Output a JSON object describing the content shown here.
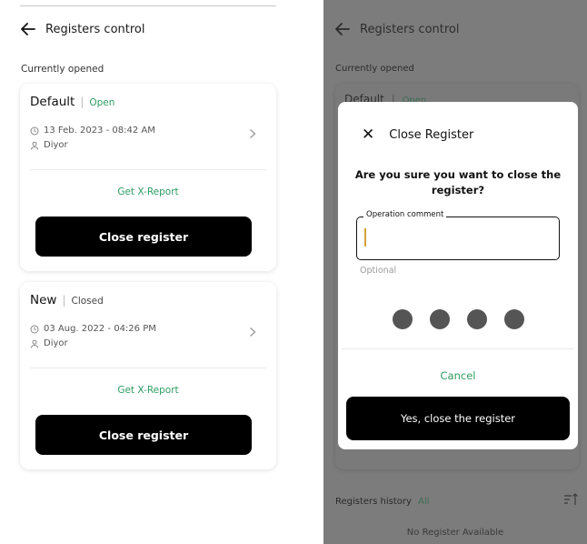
{
  "left": {
    "title": "Registers control",
    "section_label": "Currently opened",
    "cards": [
      {
        "name": "Default",
        "status": "Open",
        "datetime": "13 Feb. 2023 - 08:42 AM",
        "user": "Diyor",
        "report_label": "Get X-Report",
        "close_label": "Close register"
      },
      {
        "name": "New",
        "status": "Closed",
        "datetime": "03 Aug. 2022 - 04:26 PM",
        "user": "Diyor",
        "report_label": "Get X-Report",
        "close_label": "Close register"
      }
    ]
  },
  "right": {
    "title": "Registers control",
    "section_label": "Currently opened",
    "peek_name": "Default",
    "peek_status": "Open",
    "history_label": "Registers history",
    "history_filter": "All",
    "empty_text": "No Register Available",
    "modal": {
      "title": "Close Register",
      "question": "Are you sure you want to close the register?",
      "field_label": "Operation comment",
      "field_value": "",
      "optional_hint": "Optional",
      "pin_dots": 4,
      "cancel_label": "Cancel",
      "confirm_label": "Yes, close the register"
    }
  },
  "colors": {
    "accent_green": "#2e9b63",
    "button_black": "#000000",
    "overlay_gray": "#7c7c7c"
  },
  "icons": [
    "back-arrow-icon",
    "clock-icon",
    "user-icon",
    "chevron-right-icon",
    "close-icon",
    "sort-icon"
  ]
}
